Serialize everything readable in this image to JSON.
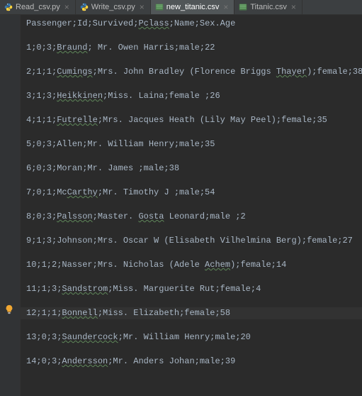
{
  "tabs": [
    {
      "icon": "py",
      "label": "Read_csv.py",
      "active": false
    },
    {
      "icon": "py",
      "label": "Write_csv.py",
      "active": false
    },
    {
      "icon": "csv",
      "label": "new_titanic.csv",
      "active": true
    },
    {
      "icon": "csv",
      "label": "Titanic.csv",
      "active": false
    }
  ],
  "icons": {
    "bulb": "bulb-icon"
  },
  "lines": [
    [
      {
        "t": "Passenger;Id;Survived;",
        "s": false
      },
      {
        "t": "Pclass",
        "s": true
      },
      {
        "t": ";Name;Sex.Age",
        "s": false
      }
    ],
    [],
    [
      {
        "t": "1;0;3;",
        "s": false
      },
      {
        "t": "Braund",
        "s": true
      },
      {
        "t": "; Mr. Owen Harris;male;22",
        "s": false
      }
    ],
    [],
    [
      {
        "t": "2;1;1;",
        "s": false
      },
      {
        "t": "Cumings",
        "s": true
      },
      {
        "t": ";Mrs. John Bradley (Florence Briggs ",
        "s": false
      },
      {
        "t": "Thayer",
        "s": true
      },
      {
        "t": ");female;38",
        "s": false
      }
    ],
    [],
    [
      {
        "t": "3;1;3;",
        "s": false
      },
      {
        "t": "Heikkinen",
        "s": true
      },
      {
        "t": ";Miss. Laina;female ;26",
        "s": false
      }
    ],
    [],
    [
      {
        "t": "4;1;1;",
        "s": false
      },
      {
        "t": "Futrelle",
        "s": true
      },
      {
        "t": ";Mrs. Jacques Heath (Lily May Peel);female;35",
        "s": false
      }
    ],
    [],
    [
      {
        "t": "5;0;3;Allen;Mr. William Henry;male;35",
        "s": false
      }
    ],
    [],
    [
      {
        "t": "6;0;3;Moran;Mr. James ;male;38",
        "s": false
      }
    ],
    [],
    [
      {
        "t": "7;0;1;Mc",
        "s": false
      },
      {
        "t": "Carthy",
        "s": true
      },
      {
        "t": ";Mr. Timothy J ;male;54",
        "s": false
      }
    ],
    [],
    [
      {
        "t": "8;0;3;",
        "s": false
      },
      {
        "t": "Palsson",
        "s": true
      },
      {
        "t": ";Master. ",
        "s": false
      },
      {
        "t": "Gosta",
        "s": true
      },
      {
        "t": " Leonard;male ;2",
        "s": false
      }
    ],
    [],
    [
      {
        "t": "9;1;3;Johnson;Mrs. Oscar W (Elisabeth Vilhelmina Berg);female;27",
        "s": false
      }
    ],
    [],
    [
      {
        "t": "10;1;2;Nasser;Mrs. Nicholas (Adele ",
        "s": false
      },
      {
        "t": "Achem",
        "s": true
      },
      {
        "t": ");female;14",
        "s": false
      }
    ],
    [],
    [
      {
        "t": "11;1;3;",
        "s": false
      },
      {
        "t": "Sandstrom",
        "s": true
      },
      {
        "t": ";Miss. Marguerite Rut;female;4",
        "s": false
      }
    ],
    [],
    [
      {
        "t": "12;1;1;",
        "s": false,
        "bulb": true
      },
      {
        "t": "Bonnell",
        "s": true
      },
      {
        "t": ";Miss. Elizabeth;female;58",
        "s": false
      }
    ],
    [],
    [
      {
        "t": "13;0;3;",
        "s": false
      },
      {
        "t": "Saundercock",
        "s": true
      },
      {
        "t": ";Mr. William Henry;male;20",
        "s": false
      }
    ],
    [],
    [
      {
        "t": "14;0;3;",
        "s": false
      },
      {
        "t": "Andersson",
        "s": true
      },
      {
        "t": ";Mr. Anders Johan;male;39",
        "s": false
      }
    ]
  ]
}
